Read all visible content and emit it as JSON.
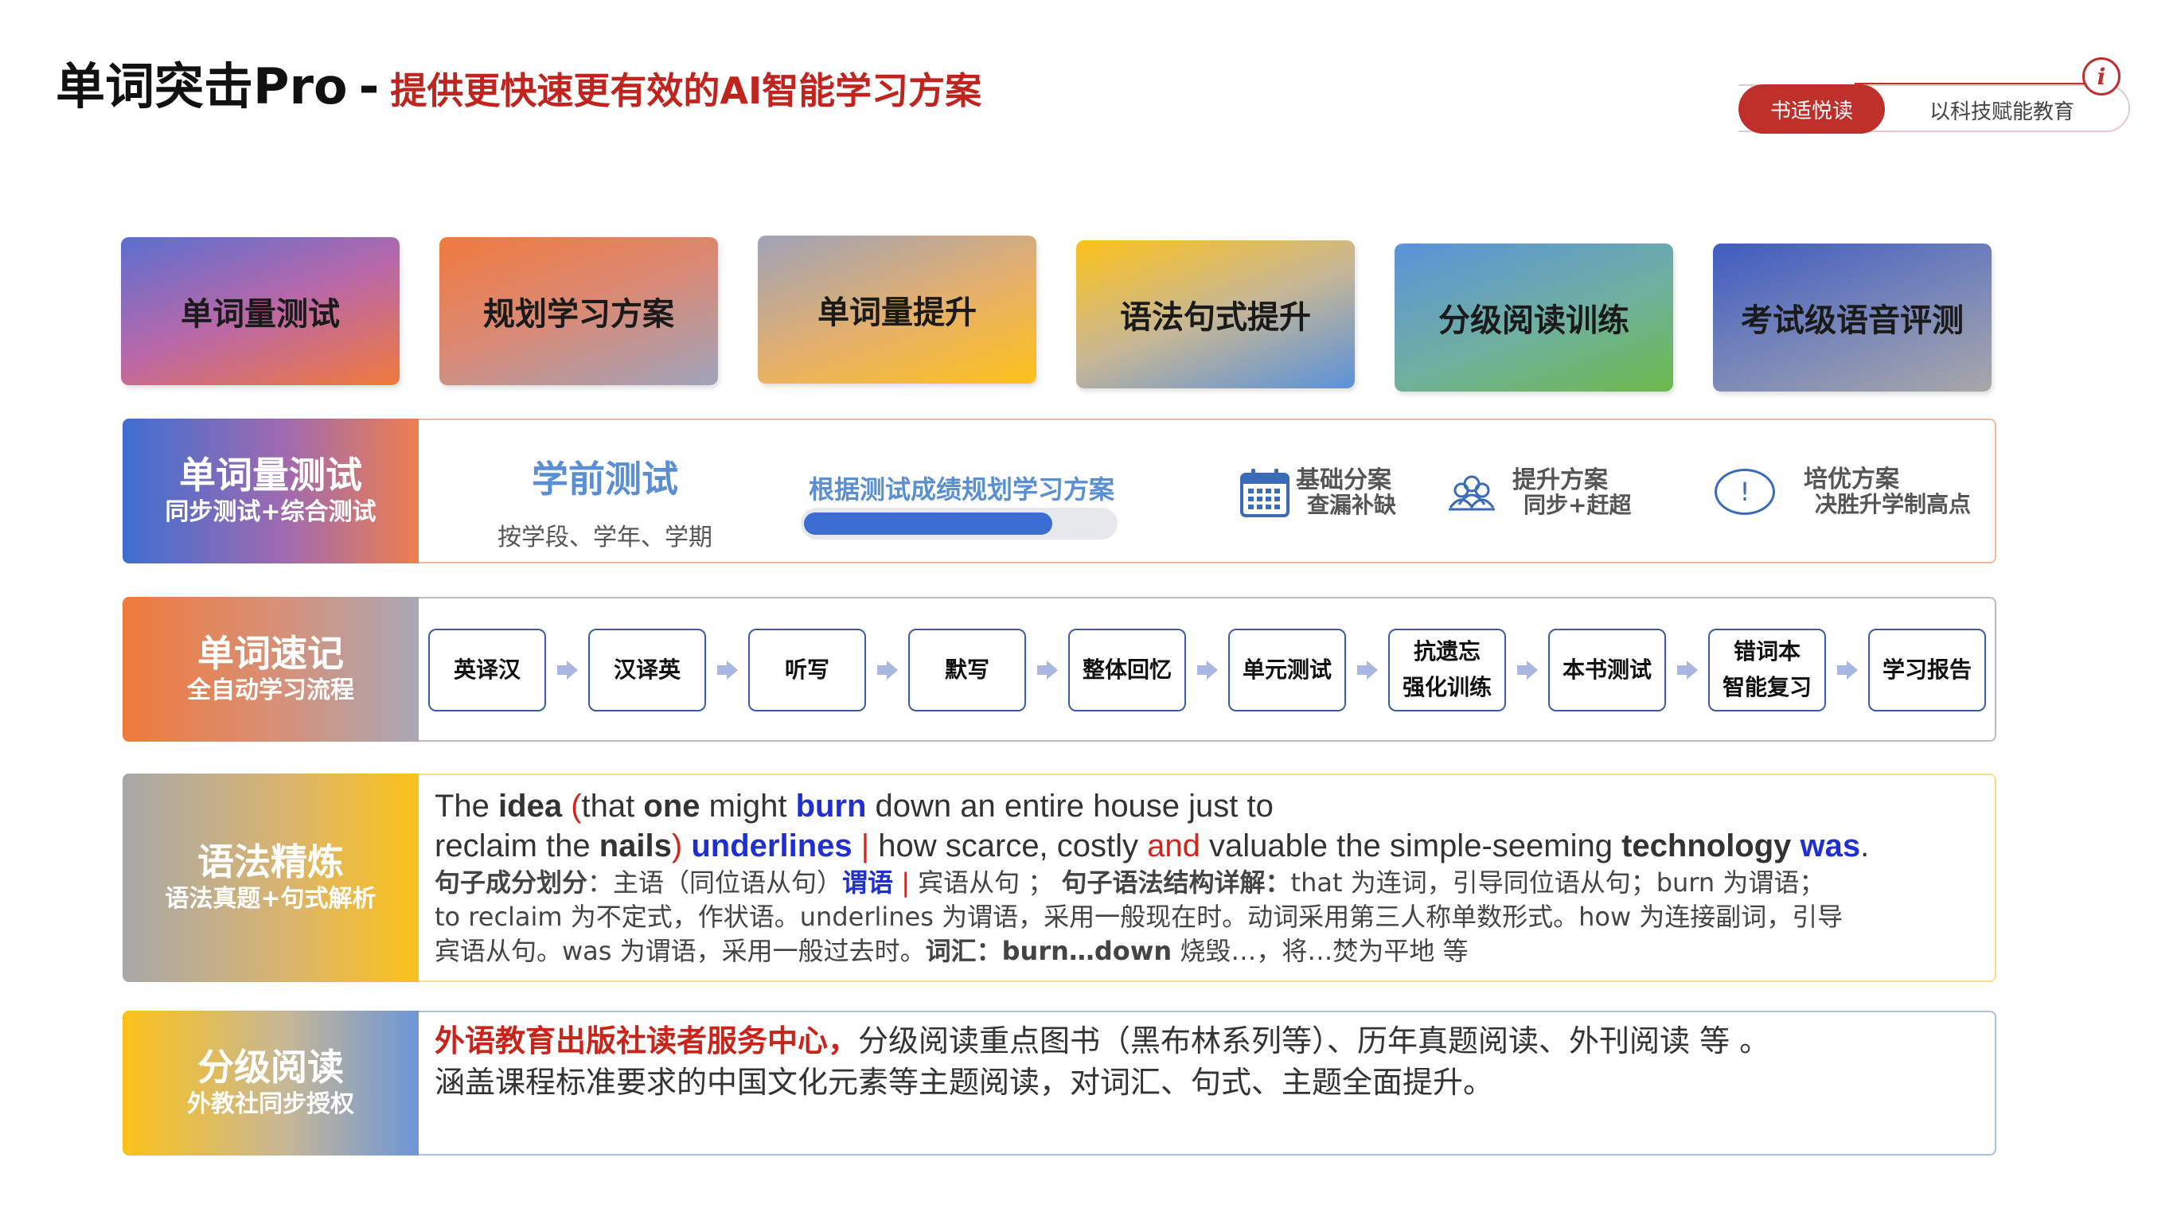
{
  "header": {
    "title": "单词突击Pro",
    "dash": "-",
    "subtitle": "提供更快速更有效的AI智能学习方案",
    "brand_name": "书适悦读",
    "brand_slogan": "以科技赋能教育",
    "info_icon": "info-icon",
    "accent_color": "#c0302a"
  },
  "cards": [
    "单词量测试",
    "规划学习方案",
    "单词量提升",
    "语法句式提升",
    "分级阅读训练",
    "考试级语音评测"
  ],
  "vocab_test": {
    "label_title": "单词量测试",
    "label_sub": "同步测试+综合测试",
    "pre_test_title": "学前测试",
    "pre_test_sub": "按学段、学年、学期",
    "plan_label": "根据测试成绩规划学习方案",
    "progress": 0.8,
    "plans": [
      {
        "icon": "calendar-icon",
        "name": "基础分案",
        "desc": "查漏补缺"
      },
      {
        "icon": "group-icon",
        "name": "提升方案",
        "desc": "同步+赶超"
      },
      {
        "icon": "alert-icon",
        "name": "培优方案",
        "desc": "决胜升学制高点"
      }
    ]
  },
  "word_memory": {
    "label_title": "单词速记",
    "label_sub": "全自动学习流程",
    "steps": [
      "英译汉",
      "汉译英",
      "听写",
      "默写",
      "整体回忆",
      "单元测试",
      "抗遗忘\n强化训练",
      "本书测试",
      "错词本\n智能复习",
      "学习报告"
    ]
  },
  "grammar": {
    "label_title": "语法精炼",
    "label_sub": "语法真题+句式解析",
    "line1": [
      {
        "t": "The ",
        "s": ""
      },
      {
        "t": "idea",
        "s": "b"
      },
      {
        "t": " ",
        "s": ""
      },
      {
        "t": "(",
        "s": "red"
      },
      {
        "t": "that ",
        "s": ""
      },
      {
        "t": "one",
        "s": "b"
      },
      {
        "t": " might ",
        "s": ""
      },
      {
        "t": "burn",
        "s": "blue"
      },
      {
        "t": " down an entire house just to",
        "s": ""
      }
    ],
    "line2": [
      {
        "t": "reclaim the ",
        "s": ""
      },
      {
        "t": "nails",
        "s": "b"
      },
      {
        "t": ")",
        "s": "red"
      },
      {
        "t": " ",
        "s": ""
      },
      {
        "t": "underlines",
        "s": "blue"
      },
      {
        "t": " ",
        "s": ""
      },
      {
        "t": "|",
        "s": "red"
      },
      {
        "t": " how scarce, costly ",
        "s": ""
      },
      {
        "t": "and",
        "s": "red"
      },
      {
        "t": " valuable the simple-seeming ",
        "s": ""
      },
      {
        "t": "technology",
        "s": "b"
      },
      {
        "t": " ",
        "s": ""
      },
      {
        "t": "was",
        "s": "blue"
      },
      {
        "t": ".",
        "s": ""
      }
    ],
    "line3": [
      {
        "t": "句子成分划分",
        "s": "b"
      },
      {
        "t": "：主语（同位语从句）",
        "s": ""
      },
      {
        "t": "谓语",
        "s": "blue"
      },
      {
        "t": " ",
        "s": ""
      },
      {
        "t": "|",
        "s": "red"
      },
      {
        "t": " 宾语从句 ； ",
        "s": ""
      },
      {
        "t": "句子语法结构详解：",
        "s": "b"
      },
      {
        "t": "that 为连词，引导同位语从句；burn 为谓语；",
        "s": ""
      }
    ],
    "line4": [
      {
        "t": "to reclaim 为不定式，作状语。underlines 为谓语，采用一般现在时。动词采用第三人称单数形式。how 为连接副词，引导",
        "s": ""
      }
    ],
    "line5": [
      {
        "t": "宾语从句。was 为谓语，采用一般过去时。",
        "s": ""
      },
      {
        "t": "词汇：burn…down",
        "s": "b"
      },
      {
        "t": "  烧毁…，将…焚为平地 等",
        "s": ""
      }
    ]
  },
  "reading": {
    "label_title": "分级阅读",
    "label_sub": "外教社同步授权",
    "highlight": "外语教育出版社读者服务中心，",
    "line1_rest": "分级阅读重点图书（黑布林系列等）、历年真题阅读、外刊阅读 等 。",
    "line2": "涵盖课程标准要求的中国文化元素等主题阅读，对词汇、句式、主题全面提升。"
  }
}
